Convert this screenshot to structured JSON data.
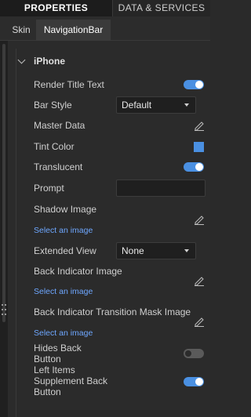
{
  "tabs": {
    "properties": "PROPERTIES",
    "data_services": "DATA & SERVICES"
  },
  "subtabs": {
    "skin": "Skin",
    "navigation_bar": "NavigationBar"
  },
  "section": {
    "title": "iPhone"
  },
  "fields": {
    "render_title_text": "Render Title Text",
    "bar_style": "Bar Style",
    "bar_style_value": "Default",
    "master_data": "Master Data",
    "tint_color": "Tint Color",
    "tint_color_value": "#4a90e2",
    "translucent": "Translucent",
    "prompt": "Prompt",
    "shadow_image": "Shadow Image",
    "shadow_image_link": "Select an image",
    "extended_view": "Extended View",
    "extended_view_value": "None",
    "back_indicator_image": "Back Indicator Image",
    "back_indicator_image_link": "Select an image",
    "back_indicator_transition_mask_image": "Back Indicator Transition Mask Image",
    "back_indicator_transition_mask_image_link": "Select an image",
    "hides_back_button_line1": "Hides Back",
    "hides_back_button_line2": "Button",
    "left_items_supplement_line1": "Left Items",
    "left_items_supplement_line2": "Supplement Back",
    "left_items_supplement_line3": "Button"
  },
  "toggles": {
    "render_title_text": true,
    "translucent": true,
    "hides_back_button": false,
    "left_items_supplement_back_button": true
  }
}
